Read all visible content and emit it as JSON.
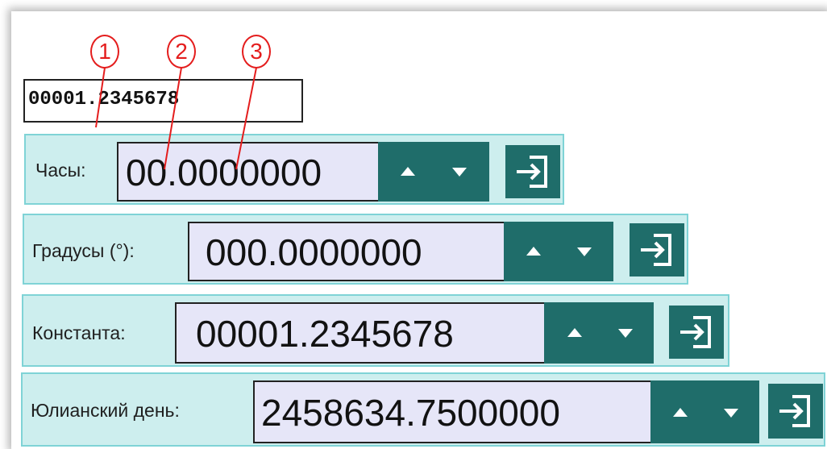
{
  "top_display": {
    "value": "00001.2345678"
  },
  "markers": [
    "1",
    "2",
    "3"
  ],
  "rows": [
    {
      "label": "Часы:",
      "value": "00.0000000"
    },
    {
      "label": "Градусы (°):",
      "value": "000.0000000"
    },
    {
      "label": "Константа:",
      "value": "00001.2345678"
    },
    {
      "label": "Юлианский день:",
      "value": "2458634.7500000"
    }
  ],
  "colors": {
    "row_bg": "#cdeeee",
    "row_border": "#7fd3d6",
    "value_bg": "#e6e6f8",
    "button_teal": "#1f6d6a",
    "marker_red": "#e41d1d"
  },
  "icons": [
    "caret-up-icon",
    "caret-down-icon",
    "enter-icon"
  ]
}
